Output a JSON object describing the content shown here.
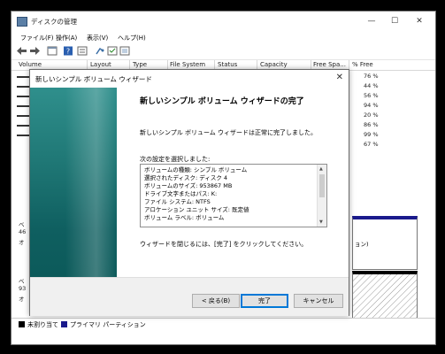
{
  "window": {
    "title": "ディスクの管理",
    "caption_buttons": [
      "—",
      "☐",
      "✕"
    ]
  },
  "menu": [
    "ファイル(F)",
    "操作(A)",
    "表示(V)",
    "ヘルプ(H)"
  ],
  "columns": [
    "Volume",
    "Layout",
    "Type",
    "File System",
    "Status",
    "Capacity",
    "Free Spa...",
    "% Free"
  ],
  "pct_free": [
    "76 %",
    "44 %",
    "56 %",
    "94 %",
    "20 %",
    "86 %",
    "99 %",
    "67 %"
  ],
  "lower_labels": [
    {
      "a": "ベ",
      "b": "46",
      "c": "オ"
    },
    {
      "a": "ベ",
      "b": "93",
      "c": "オ"
    }
  ],
  "lower_right_partial": "ョン)",
  "legend": [
    {
      "label": "未割り当て",
      "color": "#000000"
    },
    {
      "label": "プライマリ パーティション",
      "color": "#1a1a8c"
    }
  ],
  "dialog": {
    "title": "新しいシンプル ボリューム ウィザード",
    "close": "✕",
    "heading": "新しいシンプル ボリューム ウィザードの完了",
    "message": "新しいシンプル ボリューム ウィザードは正常に完了しました。",
    "selection_label": "次の設定を選択しました:",
    "settings": [
      "ボリュームの種類: シンプル ボリューム",
      "選択されたディスク: ディスク 4",
      "ボリュームのサイズ: 953867 MB",
      "ドライブ文字またはパス: K:",
      "ファイル システム: NTFS",
      "アロケーション ユニット サイズ: 既定値",
      "ボリューム ラベル: ボリューム"
    ],
    "close_message": "ウィザードを閉じるには、[完了] をクリックしてください。",
    "buttons": {
      "back": "< 戻る(B)",
      "finish": "完了",
      "cancel": "キャンセル"
    }
  }
}
